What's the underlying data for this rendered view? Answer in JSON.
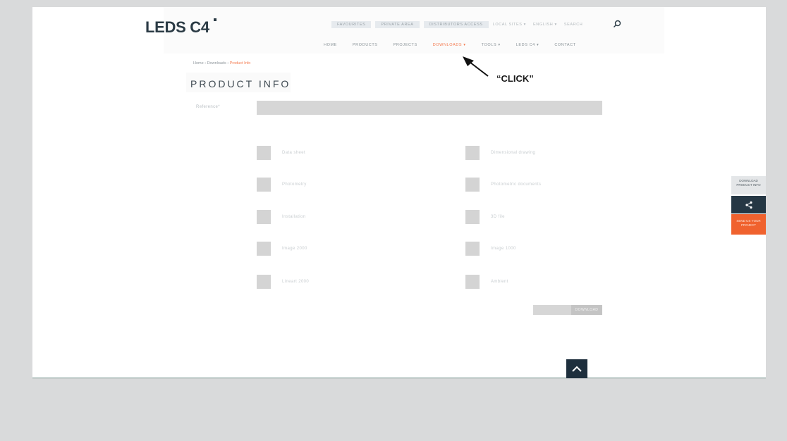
{
  "header": {
    "logo_text": "LEDS C4",
    "top_links": [
      "FAVOURITES",
      "PRIVATE AREA",
      "DISTRIBUTORS ACCESS",
      "LOCAL SITES ▾",
      "ENGLISH ▾",
      "SEARCH"
    ],
    "nav_items": [
      "HOME",
      "PRODUCTS",
      "PROJECTS",
      "DOWNLOADS ▾",
      "TOOLS ▾",
      "LEDS C4 ▾",
      "CONTACT"
    ],
    "active_nav": "DOWNLOADS ▾"
  },
  "breadcrumb": {
    "parts": [
      "Home",
      "Downloads"
    ],
    "current": "Product Info"
  },
  "page_title": "PRODUCT INFO",
  "reference": {
    "label": "Reference*",
    "value": ""
  },
  "checkboxes": {
    "left": [
      "Data sheet",
      "Photometry",
      "Installation",
      "Image 2000",
      "Lineart 2000"
    ],
    "right": [
      "Dimensional drawing",
      "Photometric documents",
      "3D file",
      "Image 1000",
      "Ambient"
    ]
  },
  "submit": {
    "label": "DOWNLOAD"
  },
  "side_widgets": {
    "download": "DOWNLOAD PRODUCT INFO",
    "share_icon": "share-icon",
    "orange": "SEND US YOUR PROJECT"
  },
  "annotation": {
    "text": "“CLICK”"
  },
  "colors": {
    "accent": "#f47a4f",
    "navy": "#253744",
    "orange": "#f0622e",
    "background": "#d9dadb"
  }
}
